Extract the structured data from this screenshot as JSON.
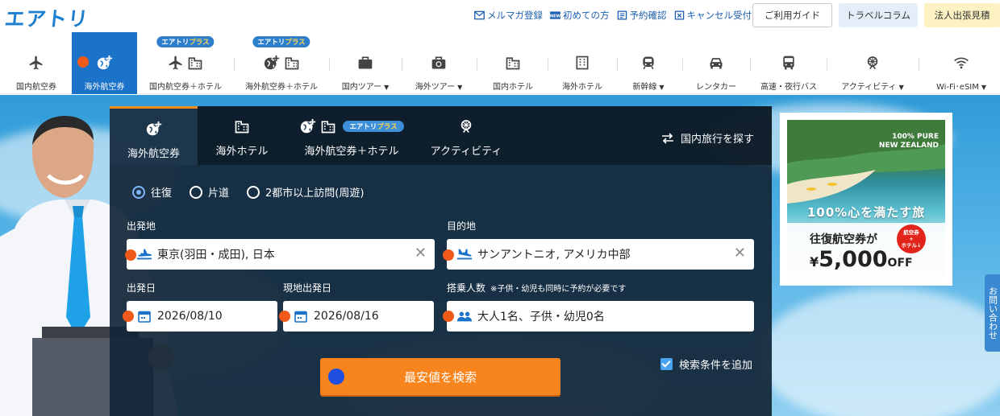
{
  "header": {
    "logo": "エアトリ",
    "links": [
      {
        "label": "メルマガ登録",
        "icon": "mail-icon"
      },
      {
        "label": "初めての方",
        "icon": "new-icon"
      },
      {
        "label": "予約確認",
        "icon": "document-icon"
      },
      {
        "label": "キャンセル受付",
        "icon": "cancel-doc-icon"
      }
    ],
    "guide_button": "ご利用ガイド",
    "column_button": "トラベルコラム",
    "corporate_button": "法人出張見積"
  },
  "nav": {
    "plus_badge_brand": "エアトリ",
    "plus_badge_suffix": "プラス",
    "items": [
      {
        "label": "国内航空券"
      },
      {
        "label": "海外航空券"
      },
      {
        "label": "国内航空券＋ホテル"
      },
      {
        "label": "海外航空券＋ホテル"
      },
      {
        "label": "国内ツアー"
      },
      {
        "label": "海外ツアー"
      },
      {
        "label": "国内ホテル"
      },
      {
        "label": "海外ホテル"
      },
      {
        "label": "新幹線"
      },
      {
        "label": "レンタカー"
      },
      {
        "label": "高速・夜行バス"
      },
      {
        "label": "アクティビティ"
      },
      {
        "label": "Wi-Fi･eSIM"
      }
    ]
  },
  "search": {
    "tabs": [
      {
        "label": "海外航空券"
      },
      {
        "label": "海外ホテル"
      },
      {
        "label": "海外航空券＋ホテル"
      },
      {
        "label": "アクティビティ"
      }
    ],
    "plus_badge_brand": "エアトリ",
    "plus_badge_suffix": "プラス",
    "domestic_link": "国内旅行を探す",
    "trip_types": [
      "往復",
      "片道",
      "2都市以上訪問(周遊)"
    ],
    "selected_trip_type": "往復",
    "origin_label": "出発地",
    "origin_value": "東京(羽田・成田), 日本",
    "destination_label": "目的地",
    "destination_value": "サンアントニオ, アメリカ中部",
    "depart_label": "出発日",
    "depart_value": "2026/08/10",
    "return_label": "現地出発日",
    "return_value": "2026/08/16",
    "passengers_label": "搭乗人数",
    "passengers_note": "※子供・幼児も同時に予約が必要です",
    "passengers_value": "大人1名、子供・幼児0名",
    "search_button": "最安値を検索",
    "add_conditions": "検索条件を追加"
  },
  "ad": {
    "header_line1": "100% PURE",
    "header_line2": "NEW ZEALAND",
    "tagline": "100%心を満たす旅",
    "line1": "往復航空券が",
    "badge_line1": "航空券",
    "badge_line2": "+",
    "badge_line3": "ホテル↓",
    "price_prefix": "¥",
    "price_amount": "5,000",
    "price_suffix": "OFF"
  },
  "contact_tab": "お問い合わせ",
  "colors": {
    "brand_blue": "#1a72c9",
    "search_orange": "#f7841c",
    "panel_bg": "#12263a"
  }
}
